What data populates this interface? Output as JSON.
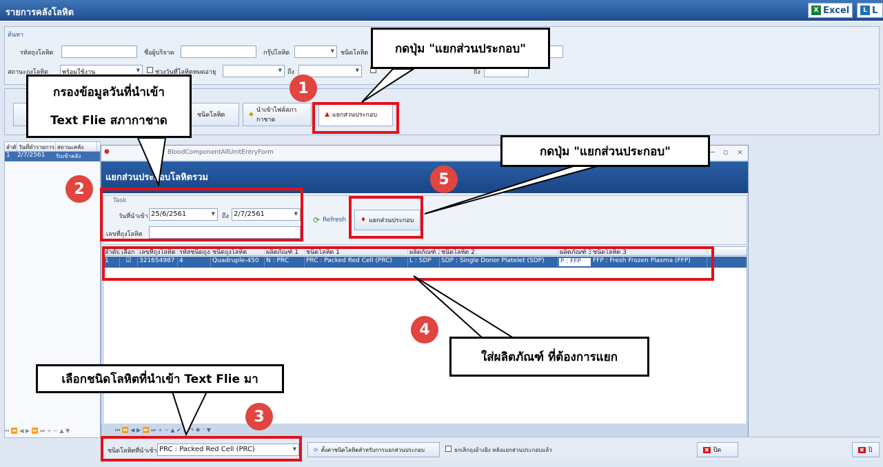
{
  "window": {
    "title": "รายการคลังโลหิต"
  },
  "toolbar": {
    "excel": "Excel",
    "l": "L"
  },
  "search": {
    "section": "ค้นหา",
    "bag_no_label": "รหัสถุงโลหิต",
    "donor_label": "ชื่อผู้บริจาค",
    "group_label": "กรุ๊ปโลหิต",
    "type_label": "ชนิดโลหิต",
    "status_label": "สถานะถุงโลหิต",
    "status_value": "พร้อมใช้งาน",
    "expire_label": "ช่วงวันที่โลหิตหมดอายุ",
    "to_label": "ถึง",
    "to_label2": "ถึง"
  },
  "buttons": {
    "import_type": "ชนิดโลหิต",
    "import_file": "นำเข้าไฟล์สภากาชาด",
    "split": "แยกส่วนประกอบ",
    "refresh": "Refresh",
    "split_dialog": "แยกส่วนประกอบ",
    "set_type": "ตั้งค่าชนิดโลหิตสำหรับการแยกส่วนประกอบ",
    "close": "ปิด",
    "close_right": "ปิ"
  },
  "left_grid": {
    "headers": [
      "ลำดับ",
      "วันที่ทำรายการ",
      "สถานะคลัง"
    ],
    "row": [
      "1",
      "2/7/2561",
      "รับเข้าคลัง"
    ],
    "nav": "⏮ ⏪ ◀ ▶ ⏩ ⏭ + − ▲ ▼"
  },
  "dialog": {
    "caption": "BloodComponentAllUnitEntryForm",
    "title": "แยกส่วนประกอบโลหิตรวม",
    "group": "Task",
    "date_label": "วันที่นำเข้า",
    "date_from": "25/6/2561",
    "to_label": "ถึง",
    "date_to": "2/7/2561",
    "bag_label": "เลขที่ถุงโลหิต",
    "headers": [
      "ลำดับ",
      "เลือก",
      "เลขที่ถุงโลหิต",
      "รหัสชนิดถุง",
      "ชนิดถุงโลหิต",
      "ผลิตภัณฑ์ 1",
      "ชนิดโลหิต 1",
      "ผลิตภัณฑ์ 2",
      "ชนิดโลหิต 2",
      "ผลิตภัณฑ์ 3",
      "ชนิดโลหิต 3"
    ],
    "row": [
      "1",
      "☑",
      "321654987",
      "4",
      "Quadruple-450",
      "N : PRC",
      "PRC : Packed Red Cell (PRC)",
      "L : SDP",
      "SDP : Single Donor Platelet (SDP)",
      "P : FFP",
      "FFP : Fresh Frozen Plasma (FFP)"
    ],
    "nav": "⏮ ⏪ ◀ ▶ ⏩ ⏭ + − ▲ ✔ ✖ ↷ ✱ ⁺ ▼"
  },
  "bottom": {
    "type_label": "ชนิดโลหิตที่นำเข้า",
    "type_value": "PRC : Packed Red Cell (PRC)",
    "cancel_check": "ยกเลิกถุงอ้างอิง หลังแยกส่วนประกอบแล้ว"
  },
  "callouts": {
    "c1": "กดปุ่ม \"แยกส่วนประกอบ\"",
    "c2a": "กรองข้อมูลวันที่นำเข้า",
    "c2b": "Text Flie สภากาชาด",
    "c3": "เลือกชนิดโลหิตที่นำเข้า Text Flie มา",
    "c4": "ใส่ผลิตภัณฑ์ ที่ต้องการแยก",
    "c5": "กดปุ่ม \"แยกส่วนประกอบ\""
  },
  "steps": [
    "1",
    "2",
    "3",
    "4",
    "5"
  ],
  "colors": {
    "accent": "#1f4f95",
    "highlight": "#e3101a",
    "badge": "#e0453f",
    "selected_row": "#3266ad"
  }
}
